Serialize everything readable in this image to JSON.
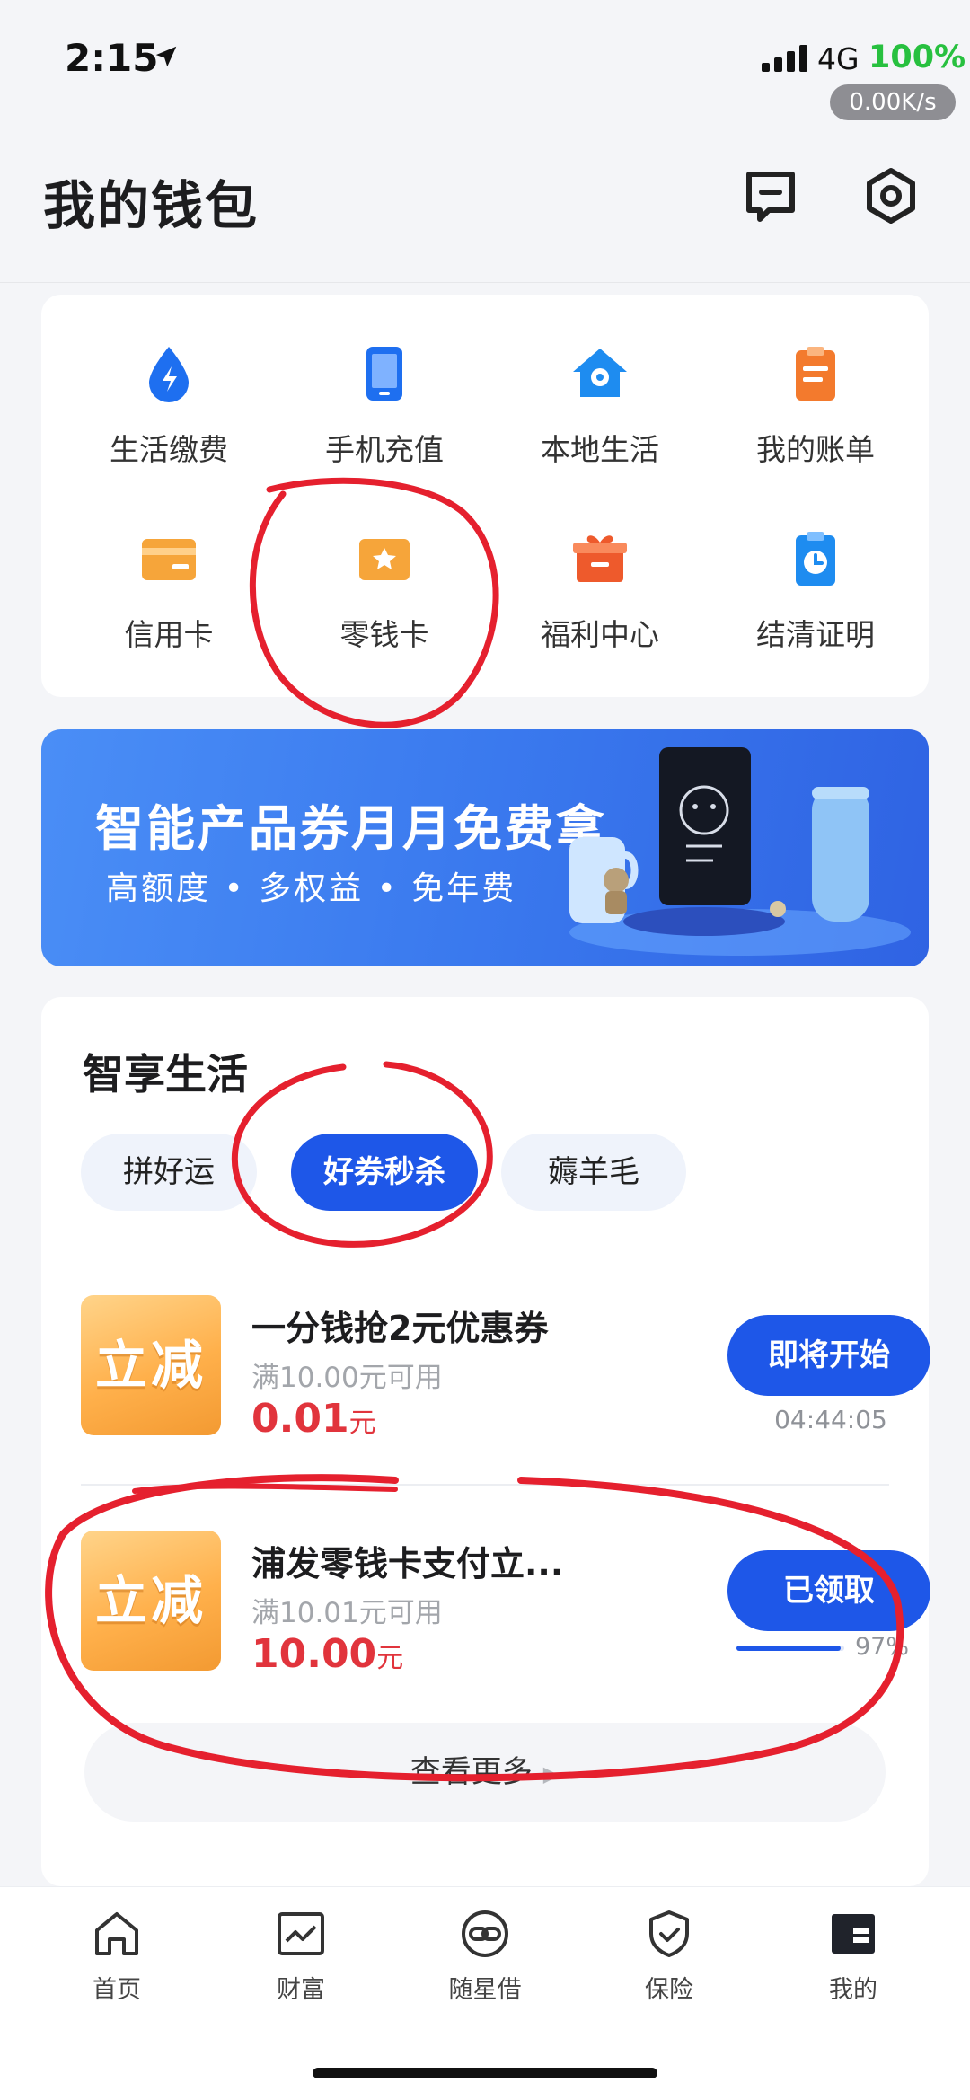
{
  "status_bar": {
    "time": "2:15",
    "network": "4G",
    "battery": "100%",
    "speed": "0.00K/s"
  },
  "header": {
    "title": "我的钱包"
  },
  "services": [
    {
      "label": "生活缴费",
      "icon": "water-drop-icon",
      "color": "#1e6ff0"
    },
    {
      "label": "手机充值",
      "icon": "phone-icon",
      "color": "#1e6ff0"
    },
    {
      "label": "本地生活",
      "icon": "home-location-icon",
      "color": "#1e8cf0"
    },
    {
      "label": "我的账单",
      "icon": "bill-icon",
      "color": "#f37a2d"
    },
    {
      "label": "信用卡",
      "icon": "credit-card-icon",
      "color": "#f6a53a"
    },
    {
      "label": "零钱卡",
      "icon": "star-card-icon",
      "color": "#f6a53a"
    },
    {
      "label": "福利中心",
      "icon": "gift-icon",
      "color": "#ee5a2c"
    },
    {
      "label": "结清证明",
      "icon": "clock-document-icon",
      "color": "#1e8cf0"
    }
  ],
  "banner": {
    "title": "智能产品券月月免费拿",
    "subtitle": "高额度 • 多权益 • 免年费"
  },
  "life": {
    "title": "智享生活",
    "tabs": [
      {
        "label": "拼好运"
      },
      {
        "label": "好券秒杀"
      },
      {
        "label": "薅羊毛"
      }
    ],
    "offers": [
      {
        "badge": "立减",
        "title": "一分钱抢2元优惠券",
        "condition": "满10.00元可用",
        "amount": "0.01",
        "unit": "元",
        "button": "即将开始",
        "countdown": "04:44:05"
      },
      {
        "badge": "立减",
        "title": "浦发零钱卡支付立...",
        "condition": "满10.01元可用",
        "amount": "10.00",
        "unit": "元",
        "button": "已领取",
        "progress_pct": "97%",
        "progress_value": 0.97
      }
    ],
    "more_label": "查看更多"
  },
  "tabbar": [
    {
      "label": "首页",
      "icon": "home-icon"
    },
    {
      "label": "财富",
      "icon": "chart-icon"
    },
    {
      "label": "随星借",
      "icon": "link-circle-icon"
    },
    {
      "label": "保险",
      "icon": "shield-check-icon"
    },
    {
      "label": "我的",
      "icon": "profile-icon"
    }
  ],
  "colors": {
    "primary": "#1e57e8",
    "price": "#e1343c",
    "badge": "#ffb04b",
    "annotation": "#e5202e"
  }
}
